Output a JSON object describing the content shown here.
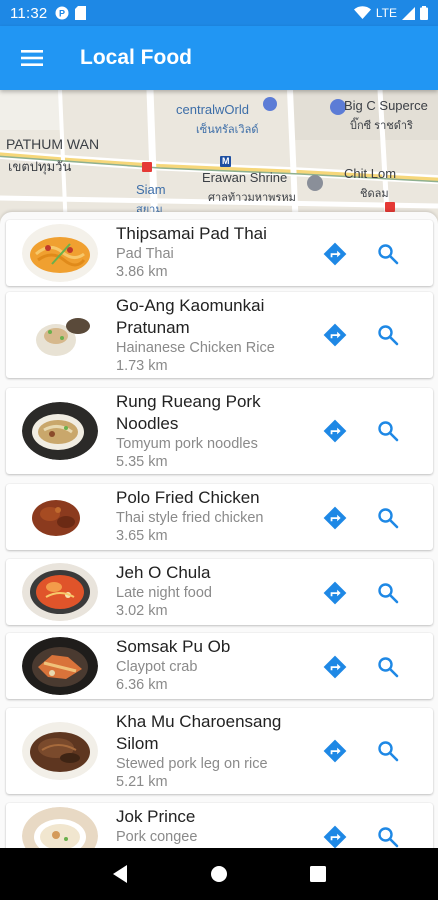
{
  "status_bar": {
    "time": "11:32",
    "network": "LTE"
  },
  "app_bar": {
    "title": "Local Food"
  },
  "map": {
    "labels": [
      "centralwOrld",
      "เซ็นทรัลเวิลด์",
      "Big C Superce",
      "บิ๊กซี ราชดำริ",
      "PATHUM WAN",
      "เขตปทุมวัน",
      "Erawan Shrine",
      "ศาลท้าวมหาพรหม",
      "Chit Lom",
      "ชิดลม",
      "Siam",
      "สยาม"
    ],
    "metro_badge": "M"
  },
  "restaurants": [
    {
      "name": "Thipsamai Pad Thai",
      "dish": "Pad Thai",
      "distance": "3.86 km"
    },
    {
      "name": "Go-Ang Kaomunkai Pratunam",
      "dish": "Hainanese Chicken Rice",
      "distance": "1.73 km"
    },
    {
      "name": "Rung Rueang Pork Noodles",
      "dish": "Tomyum pork noodles",
      "distance": "5.35 km"
    },
    {
      "name": "Polo Fried Chicken",
      "dish": "Thai style fried chicken",
      "distance": "3.65 km"
    },
    {
      "name": "Jeh O Chula",
      "dish": "Late night food",
      "distance": "3.02 km"
    },
    {
      "name": "Somsak Pu Ob",
      "dish": "Claypot crab",
      "distance": "6.36 km"
    },
    {
      "name": "Kha Mu Charoensang Silom",
      "dish": "Stewed pork leg on rice",
      "distance": "5.21 km"
    },
    {
      "name": "Jok Prince",
      "dish": "Pork congee",
      "distance": ""
    }
  ],
  "icons": {
    "menu": "hamburger-menu-icon",
    "directions": "directions-icon",
    "search": "search-icon",
    "back": "back-triangle-icon",
    "home": "home-circle-icon",
    "recents": "recents-square-icon"
  },
  "colors": {
    "primary": "#2196f3",
    "status_bar": "#1e88e5",
    "accent_icon": "#1e88e5",
    "navigation_bar": "#000000"
  }
}
